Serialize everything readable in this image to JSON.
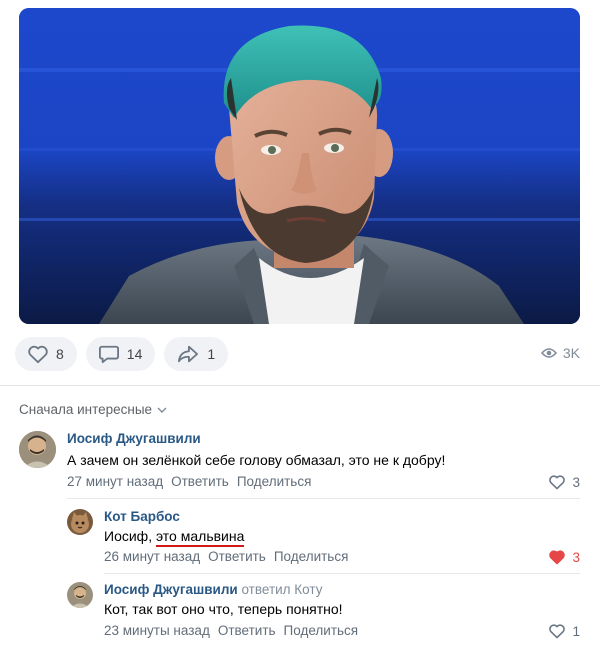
{
  "post": {
    "actions": {
      "likes": "8",
      "comments": "14",
      "shares": "1"
    },
    "views": "3K"
  },
  "comments_section": {
    "sort_label": "Сначала интересные"
  },
  "comments": [
    {
      "author": "Иосиф Джугашвили",
      "text": "А зачем он зелёнкой себе голову обмазал, это не к добру!",
      "time": "27 минут назад",
      "reply": "Ответить",
      "share": "Поделиться",
      "likes": "3"
    },
    {
      "author": "Кот Барбос",
      "text_prefix": "Иосиф, ",
      "text_highlight": "это мальвина",
      "time": "26 минут назад",
      "reply": "Ответить",
      "share": "Поделиться",
      "likes": "3",
      "liked": true,
      "like_color": "#e64646"
    },
    {
      "author": "Иосиф Джугашвили",
      "replied_to": "ответил Коту",
      "text": "Кот, так вот оно что, теперь понятно!",
      "time": "23 минуты назад",
      "reply": "Ответить",
      "share": "Поделиться",
      "likes": "1"
    }
  ],
  "colors": {
    "author_link": "#2a5885",
    "secondary": "#626d7a",
    "highlight_underline": "#d01a1a"
  }
}
